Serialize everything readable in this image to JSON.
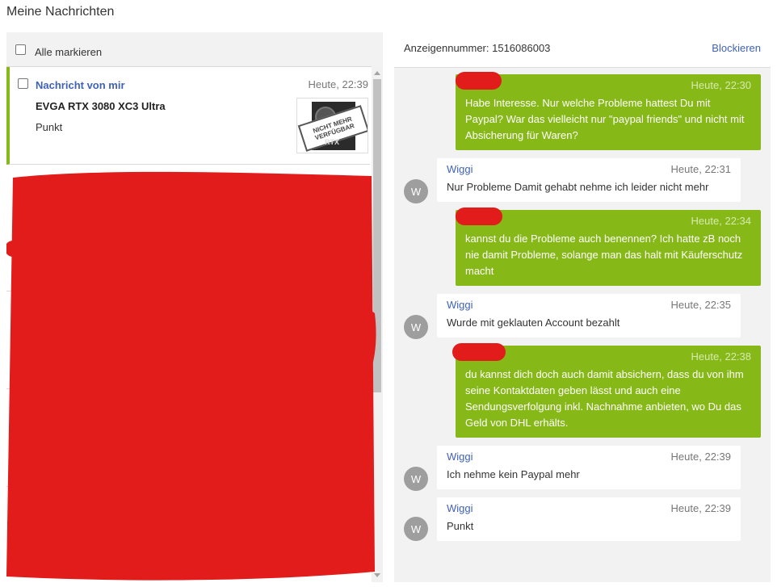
{
  "page": {
    "title": "Meine Nachrichten"
  },
  "left": {
    "select_all_label": "Alle markieren",
    "messages": [
      {
        "sender": "Nachricht von mir",
        "time": "Heute, 22:39",
        "title": "EVGA RTX 3080 XC3 Ultra",
        "preview": "Punkt",
        "thumb": {
          "stamp_line1": "NICHT MEHR",
          "stamp_line2": "VERFÜGBAR",
          "badge": "RTX"
        }
      }
    ]
  },
  "right": {
    "ad_label": "Anzeigennummer: 1516086003",
    "block_label": "Blockieren",
    "messages": [
      {
        "dir": "out",
        "time": "Heute, 22:30",
        "text": "Habe Interesse. Nur welche Probleme hattest Du mit Paypal? War das vielleicht nur \"paypal friends\" und nicht mit Absicherung für Waren?"
      },
      {
        "dir": "in",
        "sender": "Wiggi",
        "avatar": "W",
        "time": "Heute, 22:31",
        "text": "Nur Probleme Damit gehabt nehme ich leider nicht mehr"
      },
      {
        "dir": "out",
        "time": "Heute, 22:34",
        "text": "kannst du die Probleme auch benennen? Ich hatte zB noch nie damit Probleme, solange man das halt mit Käuferschutz macht"
      },
      {
        "dir": "in",
        "sender": "Wiggi",
        "avatar": "W",
        "time": "Heute, 22:35",
        "text": "Wurde mit geklauten Account bezahlt"
      },
      {
        "dir": "out",
        "time": "Heute, 22:38",
        "text": "du kannst dich doch auch damit absichern, dass du von ihm seine Kontaktdaten geben lässt und auch eine Sendungsverfolgung inkl. Nachnahme anbieten, wo Du das Geld von DHL erhälts."
      },
      {
        "dir": "in",
        "sender": "Wiggi",
        "avatar": "W",
        "time": "Heute, 22:39",
        "text": "Ich nehme kein Paypal mehr"
      },
      {
        "dir": "in",
        "sender": "Wiggi",
        "avatar": "W",
        "time": "Heute, 22:39",
        "text": "Punkt"
      }
    ]
  },
  "colors": {
    "accent_green": "#86b817",
    "link_blue": "#3f62b8",
    "redaction": "#e21b1b"
  }
}
